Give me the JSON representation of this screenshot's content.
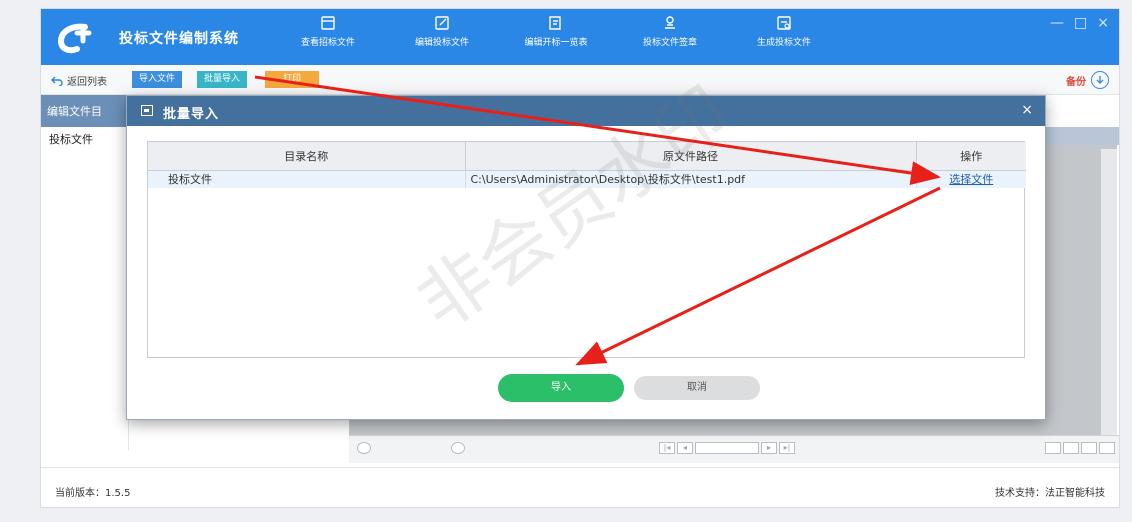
{
  "app": {
    "title": "投标文件编制系统"
  },
  "nav": [
    {
      "label": "查看招标文件",
      "icon": "document-view-icon"
    },
    {
      "label": "编辑投标文件",
      "icon": "edit-icon"
    },
    {
      "label": "编辑开标一览表",
      "icon": "edit-list-icon"
    },
    {
      "label": "投标文件签章",
      "icon": "signature-icon"
    },
    {
      "label": "生成投标文件",
      "icon": "generate-file-icon"
    }
  ],
  "window_controls": {
    "minimize": "—",
    "maximize": "□",
    "close": "×"
  },
  "toolbar": {
    "back": "返回列表",
    "import": "导入文件",
    "batch_import": "批量导入",
    "print": "打印",
    "backup": "备份"
  },
  "left_panel": {
    "header": "编辑文件目",
    "item": "投标文件"
  },
  "dialog": {
    "title": "批量导入",
    "close": "×",
    "columns": [
      "目录名称",
      "原文件路径",
      "操作"
    ],
    "rows": [
      {
        "name": "投标文件",
        "path": "C:\\Users\\Administrator\\Desktop\\投标文件\\test1.pdf",
        "action": "选择文件"
      }
    ],
    "import_button": "导入",
    "cancel_button": "取消"
  },
  "watermark": "非会员水印",
  "status": {
    "version": "当前版本：1.5.5",
    "support": "技术支持：法正智能科技"
  },
  "colors": {
    "primary": "#2b87e6",
    "dialog_header": "#44709e",
    "import_green": "#2bbf6a",
    "arrow_red": "#e8201a"
  }
}
